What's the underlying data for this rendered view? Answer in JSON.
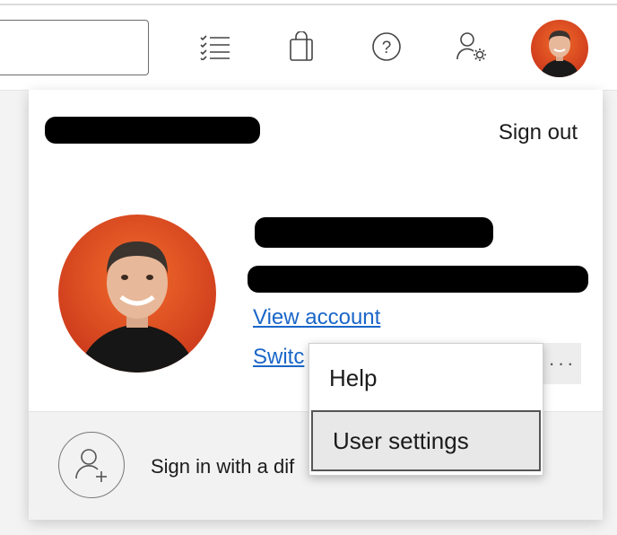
{
  "header": {
    "icons": {
      "tasks": "tasks-icon",
      "shopping": "shopping-bag-icon",
      "help": "help-icon",
      "account_settings": "account-settings-icon"
    }
  },
  "account_panel": {
    "sign_out_label": "Sign out",
    "view_account_label": "View account",
    "switch_label_partial": "Switc",
    "more_label": "···",
    "sign_in_other_label": "Sign in with a dif"
  },
  "context_menu": {
    "items": [
      {
        "label": "Help"
      },
      {
        "label": "User settings"
      }
    ]
  },
  "colors": {
    "link": "#1a66c8",
    "avatar_bg": "#e0471f"
  }
}
